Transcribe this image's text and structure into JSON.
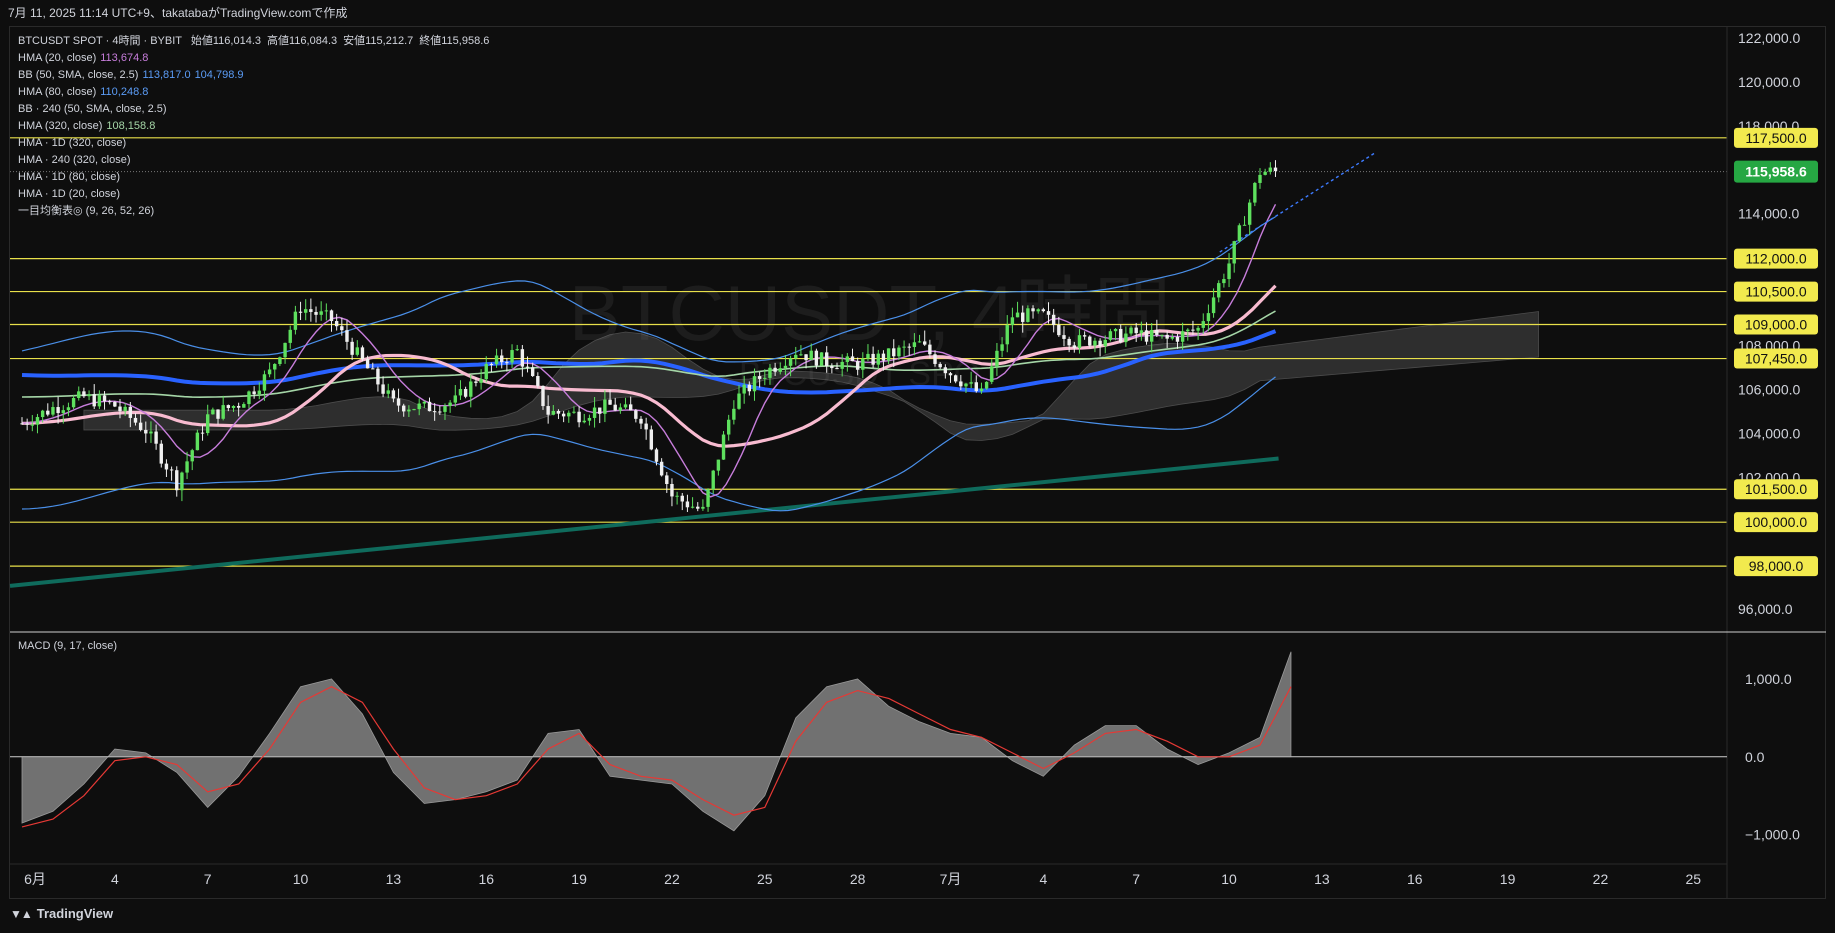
{
  "header": {
    "created_text": "7月 11, 2025 11:14 UTC+9、takatabaがTradingView.comで作成"
  },
  "legend": {
    "title": "BTCUSDT SPOT · 4時間 · BYBIT",
    "ohlc": [
      {
        "label": "始値",
        "value": "116,014.3"
      },
      {
        "label": "高値",
        "value": "116,084.3"
      },
      {
        "label": "安値",
        "value": "115,212.7"
      },
      {
        "label": "終値",
        "value": "115,958.6"
      }
    ],
    "indicators": [
      {
        "name": "HMA (20, close)",
        "values": [
          "113,674.8"
        ],
        "colors": [
          "#c77ddb"
        ]
      },
      {
        "name": "BB (50, SMA, close, 2.5)",
        "values": [
          "113,817.0",
          "104,798.9"
        ],
        "colors": [
          "#5b9cf6",
          "#5b9cf6"
        ]
      },
      {
        "name": "HMA (80, close)",
        "values": [
          "110,248.8"
        ],
        "colors": [
          "#5b9cf6"
        ]
      },
      {
        "name": "BB · 240 (50, SMA, close, 2.5)",
        "values": [],
        "colors": []
      },
      {
        "name": "HMA (320, close)",
        "values": [
          "108,158.8"
        ],
        "colors": [
          "#a5d6a7"
        ]
      },
      {
        "name": "HMA · 1D (320, close)",
        "values": [],
        "colors": []
      },
      {
        "name": "HMA · 240 (320, close)",
        "values": [],
        "colors": []
      },
      {
        "name": "HMA · 1D (80, close)",
        "values": [],
        "colors": []
      },
      {
        "name": "HMA · 1D (20, close)",
        "values": [],
        "colors": []
      },
      {
        "name": "一目均衡表◎ (9, 26, 52, 26)",
        "values": [],
        "colors": []
      }
    ]
  },
  "watermark": {
    "line1": "BTCUSDT, 4時間",
    "line2": "BTCUSDT SPOT"
  },
  "macd_legend": "MACD (9, 17, close)",
  "footer": {
    "logo_text": "TradingView"
  },
  "colors": {
    "background": "#0e0e0e",
    "up_candle": "#5ee05e",
    "down_candle": "#f0f0f0",
    "hline": "#e8e04a",
    "hma20": "#c77ddb",
    "bb_band": "#4a8fe8",
    "hma80": "#2962ff",
    "hma320": "#a5d6a7",
    "pink_ma": "#f8bbd0",
    "long_trend": "#0f6b5c",
    "cloud": "#6b6b6b",
    "macd_hist": "#8a8a8a",
    "macd_signal": "#e53935",
    "last_price_bg": "#26a743",
    "dotted_trend": "#3d7bff"
  },
  "chart_data": [
    {
      "type": "candlestick",
      "title": "BTCUSDT SPOT · 4時間 · BYBIT",
      "ylim": [
        95000,
        122500
      ],
      "y_ticks": [
        "122,000.0",
        "120,000.0",
        "118,000.0",
        "114,000.0",
        "108,000.0",
        "106,000.0",
        "104,000.0",
        "102,000.0",
        "96,000.0"
      ],
      "x_ticks": [
        "6月",
        "4",
        "7",
        "10",
        "13",
        "16",
        "19",
        "22",
        "25",
        "28",
        "7月",
        "4",
        "7",
        "10",
        "13",
        "16",
        "19",
        "22",
        "25"
      ],
      "horizontal_levels": [
        {
          "value": 117500,
          "label": "117,500.0"
        },
        {
          "value": 112000,
          "label": "112,000.0"
        },
        {
          "value": 110500,
          "label": "110,500.0"
        },
        {
          "value": 109000,
          "label": "109,000.0"
        },
        {
          "value": 107450,
          "label": "107,450.0"
        },
        {
          "value": 101500,
          "label": "101,500.0"
        },
        {
          "value": 100000,
          "label": "100,000.0"
        },
        {
          "value": 98000,
          "label": "98,000.0"
        }
      ],
      "last_price": {
        "value": 115958.6,
        "label": "115,958.6"
      },
      "close_path": [
        {
          "x": "6月1",
          "y": 104500
        },
        {
          "x": "6月2",
          "y": 105200
        },
        {
          "x": "6月3",
          "y": 105700
        },
        {
          "x": "6月4",
          "y": 105300
        },
        {
          "x": "6月5",
          "y": 104200
        },
        {
          "x": "6月6",
          "y": 101800
        },
        {
          "x": "6月7",
          "y": 104800
        },
        {
          "x": "6月8",
          "y": 105400
        },
        {
          "x": "6月9",
          "y": 106800
        },
        {
          "x": "6月10",
          "y": 109800
        },
        {
          "x": "6月11",
          "y": 109200
        },
        {
          "x": "6月12",
          "y": 107300
        },
        {
          "x": "6月13",
          "y": 105400
        },
        {
          "x": "6月14",
          "y": 105200
        },
        {
          "x": "6月15",
          "y": 105500
        },
        {
          "x": "6月16",
          "y": 107000
        },
        {
          "x": "6月17",
          "y": 107800
        },
        {
          "x": "6月18",
          "y": 105000
        },
        {
          "x": "6月19",
          "y": 104900
        },
        {
          "x": "6月20",
          "y": 105300
        },
        {
          "x": "6月21",
          "y": 104800
        },
        {
          "x": "6月22",
          "y": 101200
        },
        {
          "x": "6月23",
          "y": 100500
        },
        {
          "x": "6月24",
          "y": 105500
        },
        {
          "x": "6月25",
          "y": 106800
        },
        {
          "x": "6月26",
          "y": 107800
        },
        {
          "x": "6月27",
          "y": 107300
        },
        {
          "x": "6月28",
          "y": 107200
        },
        {
          "x": "6月29",
          "y": 107600
        },
        {
          "x": "6月30",
          "y": 108100
        },
        {
          "x": "7月1",
          "y": 106800
        },
        {
          "x": "7月2",
          "y": 105800
        },
        {
          "x": "7月3",
          "y": 109400
        },
        {
          "x": "7月4",
          "y": 109400
        },
        {
          "x": "7月5",
          "y": 108200
        },
        {
          "x": "7月6",
          "y": 108400
        },
        {
          "x": "7月7",
          "y": 108600
        },
        {
          "x": "7月8",
          "y": 108300
        },
        {
          "x": "7月9",
          "y": 108800
        },
        {
          "x": "7月10",
          "y": 111800
        },
        {
          "x": "7月11",
          "y": 115958.6
        }
      ],
      "series": [
        {
          "name": "HMA (20, close)",
          "last": 113674.8
        },
        {
          "name": "BB (50, SMA, close, 2.5)",
          "last_upper": 113817.0,
          "last_lower": 104798.9
        },
        {
          "name": "HMA (80, close)",
          "last": 110248.8
        },
        {
          "name": "HMA (320, close)",
          "last": 108158.8
        }
      ]
    },
    {
      "type": "area",
      "title": "MACD (9, 17, close)",
      "ylim": [
        -1300,
        1500
      ],
      "y_ticks": [
        "1,000.0",
        "0.0",
        "−1,000.0"
      ],
      "series": [
        {
          "name": "MACD",
          "values": [
            -850,
            -700,
            -350,
            100,
            50,
            -200,
            -650,
            -250,
            300,
            900,
            1000,
            550,
            -200,
            -600,
            -550,
            -450,
            -300,
            300,
            350,
            -250,
            -300,
            -350,
            -700,
            -950,
            -500,
            500,
            900,
            1000,
            650,
            450,
            300,
            250,
            -50,
            -250,
            150,
            400,
            400,
            100,
            -100,
            50,
            250,
            1350
          ]
        },
        {
          "name": "Signal",
          "values": [
            -900,
            -800,
            -500,
            -50,
            0,
            -100,
            -450,
            -350,
            100,
            700,
            900,
            700,
            100,
            -400,
            -550,
            -500,
            -350,
            100,
            300,
            -100,
            -250,
            -300,
            -550,
            -750,
            -650,
            200,
            700,
            850,
            750,
            550,
            350,
            250,
            50,
            -150,
            50,
            300,
            350,
            200,
            0,
            0,
            150,
            900
          ]
        }
      ]
    }
  ]
}
